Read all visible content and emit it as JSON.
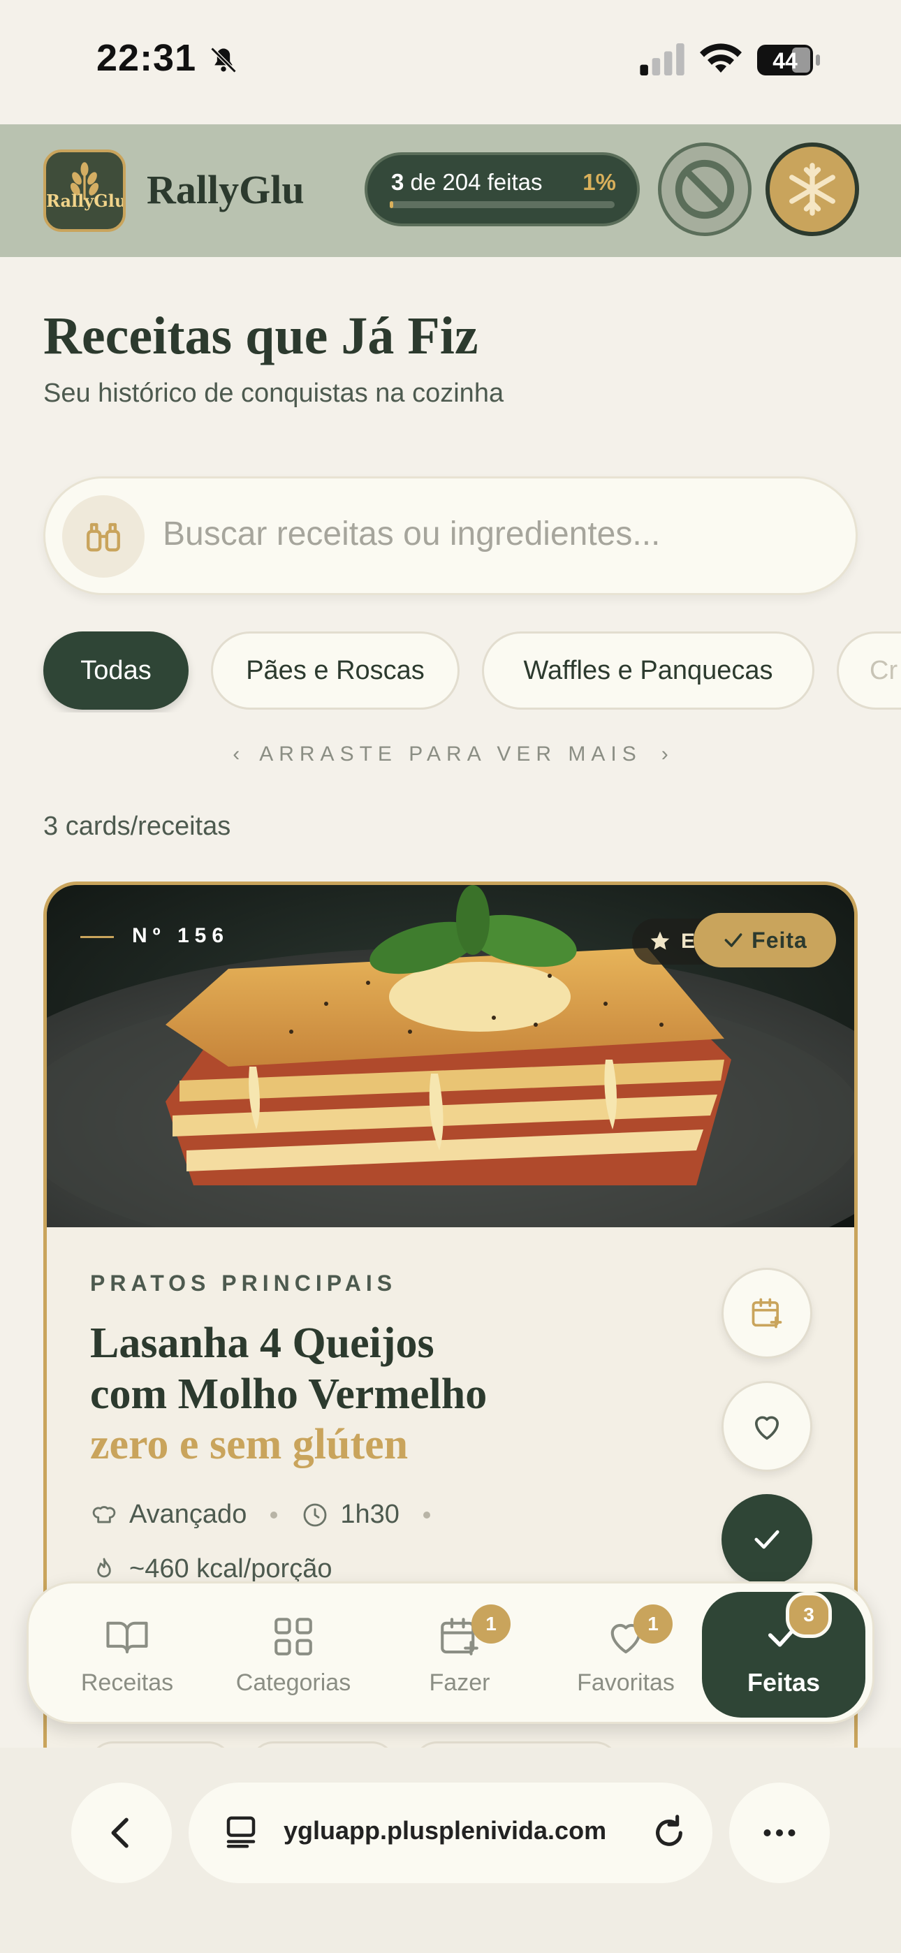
{
  "status_bar": {
    "time": "22:31",
    "battery": "44"
  },
  "header": {
    "logo_text": "RallyGlu",
    "brand": "RallyGlu",
    "progress": {
      "done_count": "3",
      "text_suffix": "de 204 feitas",
      "percent_label": "1%",
      "fraction": 0.0147
    },
    "icons": {
      "gluten_free": "no-gluten-icon",
      "frozen": "snowflake-icon"
    },
    "colors": {
      "header_bg": "#b9c2b0",
      "dark_green": "#2f4536",
      "gold": "#c9a45c"
    }
  },
  "page": {
    "title": "Receitas que Já Fiz",
    "subtitle": "Seu histórico de conquistas na cozinha"
  },
  "search": {
    "placeholder": "Buscar receitas ou ingredientes...",
    "value": ""
  },
  "categories": {
    "chips": [
      "Todas",
      "Pães e Roscas",
      "Waffles e Panquecas",
      "Cr"
    ],
    "selected": "Todas",
    "hint": "ARRASTE PARA VER MAIS"
  },
  "results_count": "3 cards/receitas",
  "card": {
    "number": "Nº 156",
    "badge_hidden_letter": "E",
    "status_badge": "Feita",
    "category": "PRATOS PRINCIPAIS",
    "title_line1": "Lasanha 4 Queijos",
    "title_line2": "com Molho Vermelho",
    "title_accent": "zero e sem glúten",
    "difficulty": "Avançado",
    "time": "1h30",
    "calories": "~460 kcal/porção"
  },
  "bottom_nav": {
    "items": [
      {
        "label": "Receitas",
        "badge": ""
      },
      {
        "label": "Categorias",
        "badge": ""
      },
      {
        "label": "Fazer",
        "badge": "1"
      },
      {
        "label": "Favoritas",
        "badge": "1"
      },
      {
        "label": "Feitas",
        "badge": "3"
      }
    ],
    "active": "Feitas"
  },
  "browser": {
    "url": "ygluapp.plusplenivida.com"
  }
}
